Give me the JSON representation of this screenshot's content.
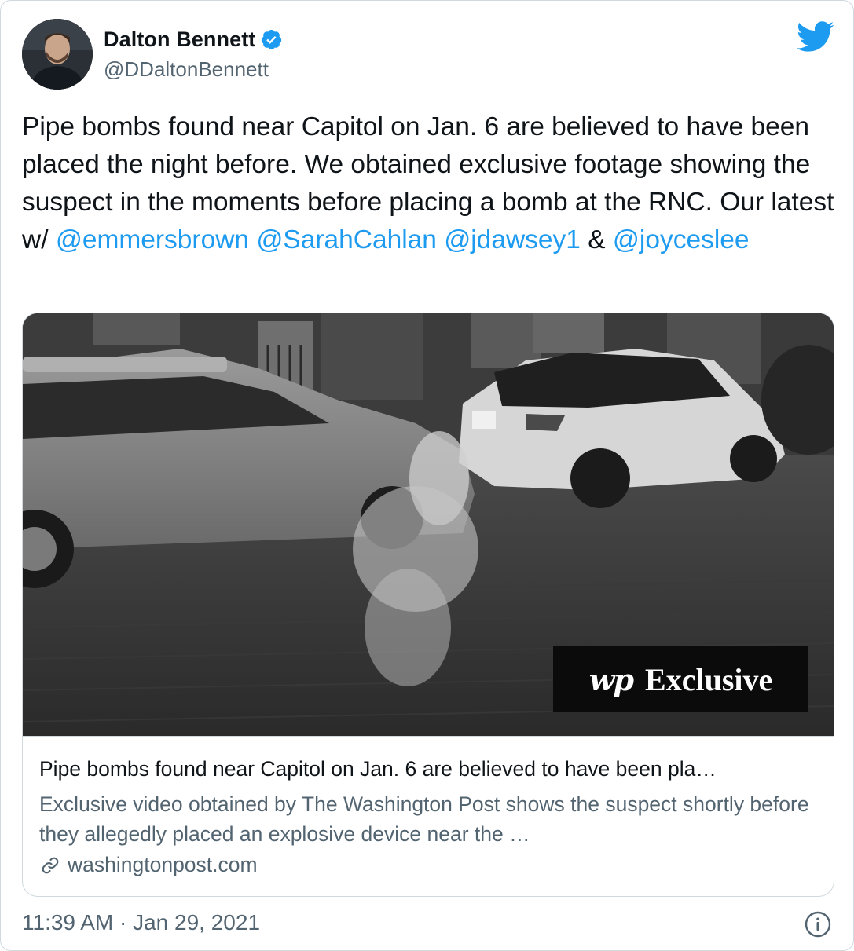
{
  "author": {
    "name": "Dalton Bennett",
    "handle": "@DDaltonBennett",
    "verified": true
  },
  "icons": {
    "verified": "verified-badge-icon",
    "brand": "twitter-bird-icon",
    "link": "link-icon",
    "info": "info-icon"
  },
  "colors": {
    "accent": "#1d9bf0",
    "secondary_text": "#536471",
    "border": "#cfd9de"
  },
  "tweet": {
    "text_part1": "Pipe bombs found near Capitol on Jan. 6 are believed to have been placed the night before. We obtained exclusive footage showing the suspect in the moments before placing a bomb at the RNC.  Our latest w/ ",
    "mention1": "@emmersbrown",
    "mention2": "@SarahCahlan",
    "mention3": "@jdawsey1",
    "amp": " & ",
    "mention4": "@joyceslee"
  },
  "card": {
    "badge_logo": "wp",
    "badge_text": "Exclusive",
    "title": "Pipe bombs found near Capitol on Jan. 6 are believed to have been pla…",
    "description": "Exclusive video obtained by The Washington Post shows the suspect shortly before they allegedly placed an explosive device near the …",
    "domain": "washingtonpost.com"
  },
  "timestamp": "11:39 AM · Jan 29, 2021"
}
